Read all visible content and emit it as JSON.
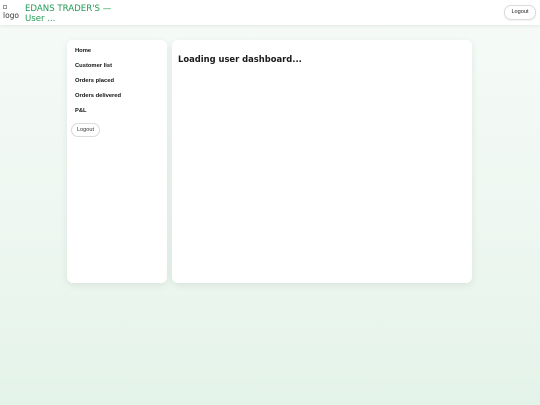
{
  "header": {
    "logo_alt": "logo",
    "title": "EDANS TRADER'S — User ...",
    "logout_label": "Logout"
  },
  "sidebar": {
    "items": [
      {
        "label": "Home"
      },
      {
        "label": "Customer list"
      },
      {
        "label": "Orders placed"
      },
      {
        "label": "Orders delivered"
      },
      {
        "label": "P&L"
      }
    ],
    "logout_label": "Logout"
  },
  "main": {
    "status": "Loading user dashboard..."
  },
  "colors": {
    "brand": "#1f9a52",
    "background": "#eef7f1"
  }
}
